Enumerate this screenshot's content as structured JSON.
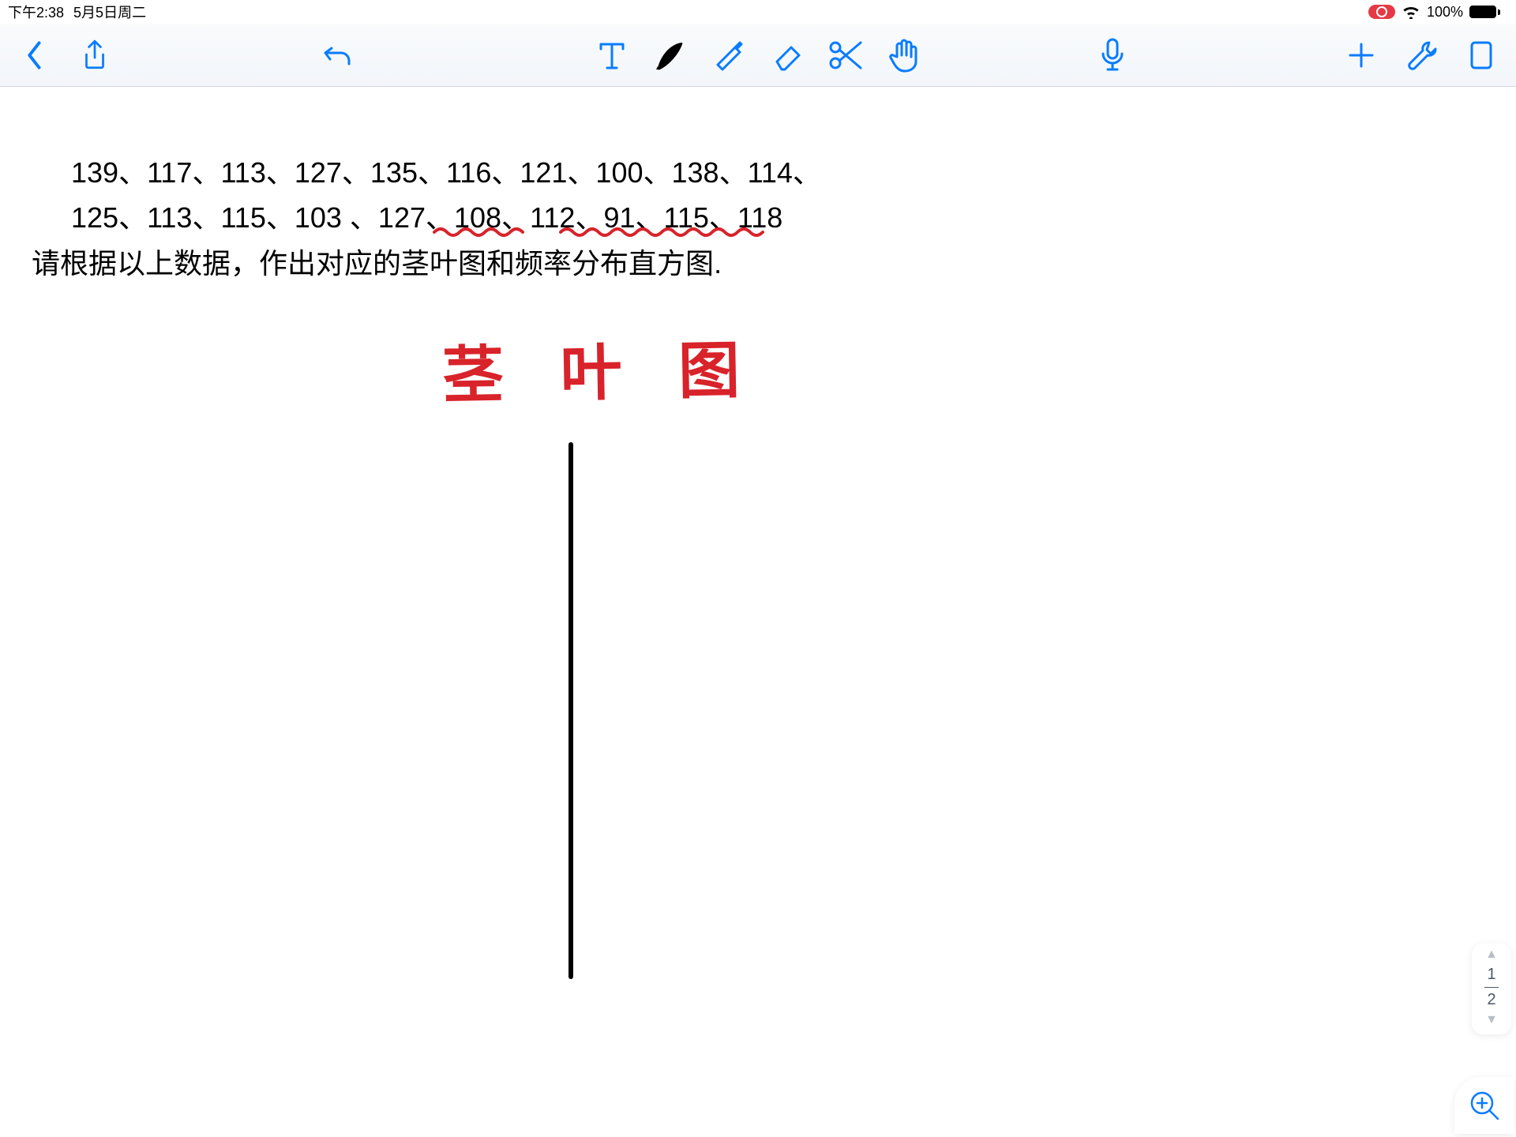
{
  "status": {
    "time": "下午2:38",
    "date": "5月5日周二",
    "battery_pct": "100%"
  },
  "content": {
    "line1": "139、117、113、127、135、116、121、100、138、114、",
    "line2": "125、113、115、103 、127、108、112、91、115、118",
    "prompt_prefix": "请根据以上数据，作出对应的",
    "underline1": "茎叶图",
    "mid": "和",
    "underline2": "频率分布直方图",
    "suffix": ".",
    "hand_title": "茎 叶 图"
  },
  "pager": {
    "current": "1",
    "total": "2"
  },
  "colors": {
    "accent": "#0a7cff",
    "red": "#d8232a"
  }
}
